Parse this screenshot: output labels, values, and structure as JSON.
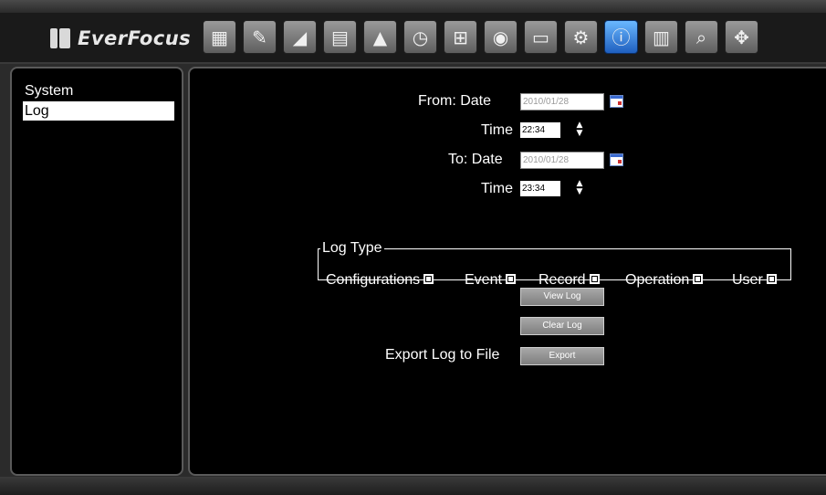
{
  "app": {
    "logo_text": "EverFocus"
  },
  "toolbar": {
    "buttons": [
      {
        "icon": "monitor-icon",
        "glyph": "▦"
      },
      {
        "icon": "wizard-icon",
        "glyph": "✎"
      },
      {
        "icon": "camera-icon",
        "glyph": "◢"
      },
      {
        "icon": "film-icon",
        "glyph": "▤"
      },
      {
        "icon": "alarm-bell-icon",
        "glyph": "▲"
      },
      {
        "icon": "schedule-icon",
        "glyph": "◷"
      },
      {
        "icon": "network-icon",
        "glyph": "⊞"
      },
      {
        "icon": "disk-icon",
        "glyph": "◉"
      },
      {
        "icon": "display-icon",
        "glyph": "▭"
      },
      {
        "icon": "settings-gear-icon",
        "glyph": "⚙"
      },
      {
        "icon": "information-icon",
        "glyph": "ⓘ",
        "active": true
      },
      {
        "icon": "archive-icon",
        "glyph": "▥"
      },
      {
        "icon": "search-icon",
        "glyph": "⌕"
      },
      {
        "icon": "ptz-arrows-icon",
        "glyph": "✥"
      }
    ]
  },
  "sidebar": {
    "items": [
      {
        "label": "System",
        "selected": false
      },
      {
        "label": "Log",
        "selected": true
      }
    ]
  },
  "form": {
    "from_date_label": "From: Date",
    "from_date_value": "2010/01/28",
    "from_time_label": "Time",
    "from_time_value": "22:34",
    "to_date_label": "To: Date",
    "to_date_value": "2010/01/28",
    "to_time_label": "Time",
    "to_time_value": "23:34"
  },
  "log_type": {
    "legend": "Log Type",
    "options": [
      {
        "label": "Configurations",
        "checked": true
      },
      {
        "label": "Event",
        "checked": true
      },
      {
        "label": "Record",
        "checked": true
      },
      {
        "label": "Operation",
        "checked": true
      },
      {
        "label": "User",
        "checked": true
      }
    ]
  },
  "actions": {
    "view_log_label": "View Log",
    "clear_log_label": "Clear Log",
    "export_prompt": "Export Log to File",
    "export_label": "Export"
  },
  "colors": {
    "active_tool": "#1f5fbf",
    "panel_border": "#5a5a5a"
  }
}
